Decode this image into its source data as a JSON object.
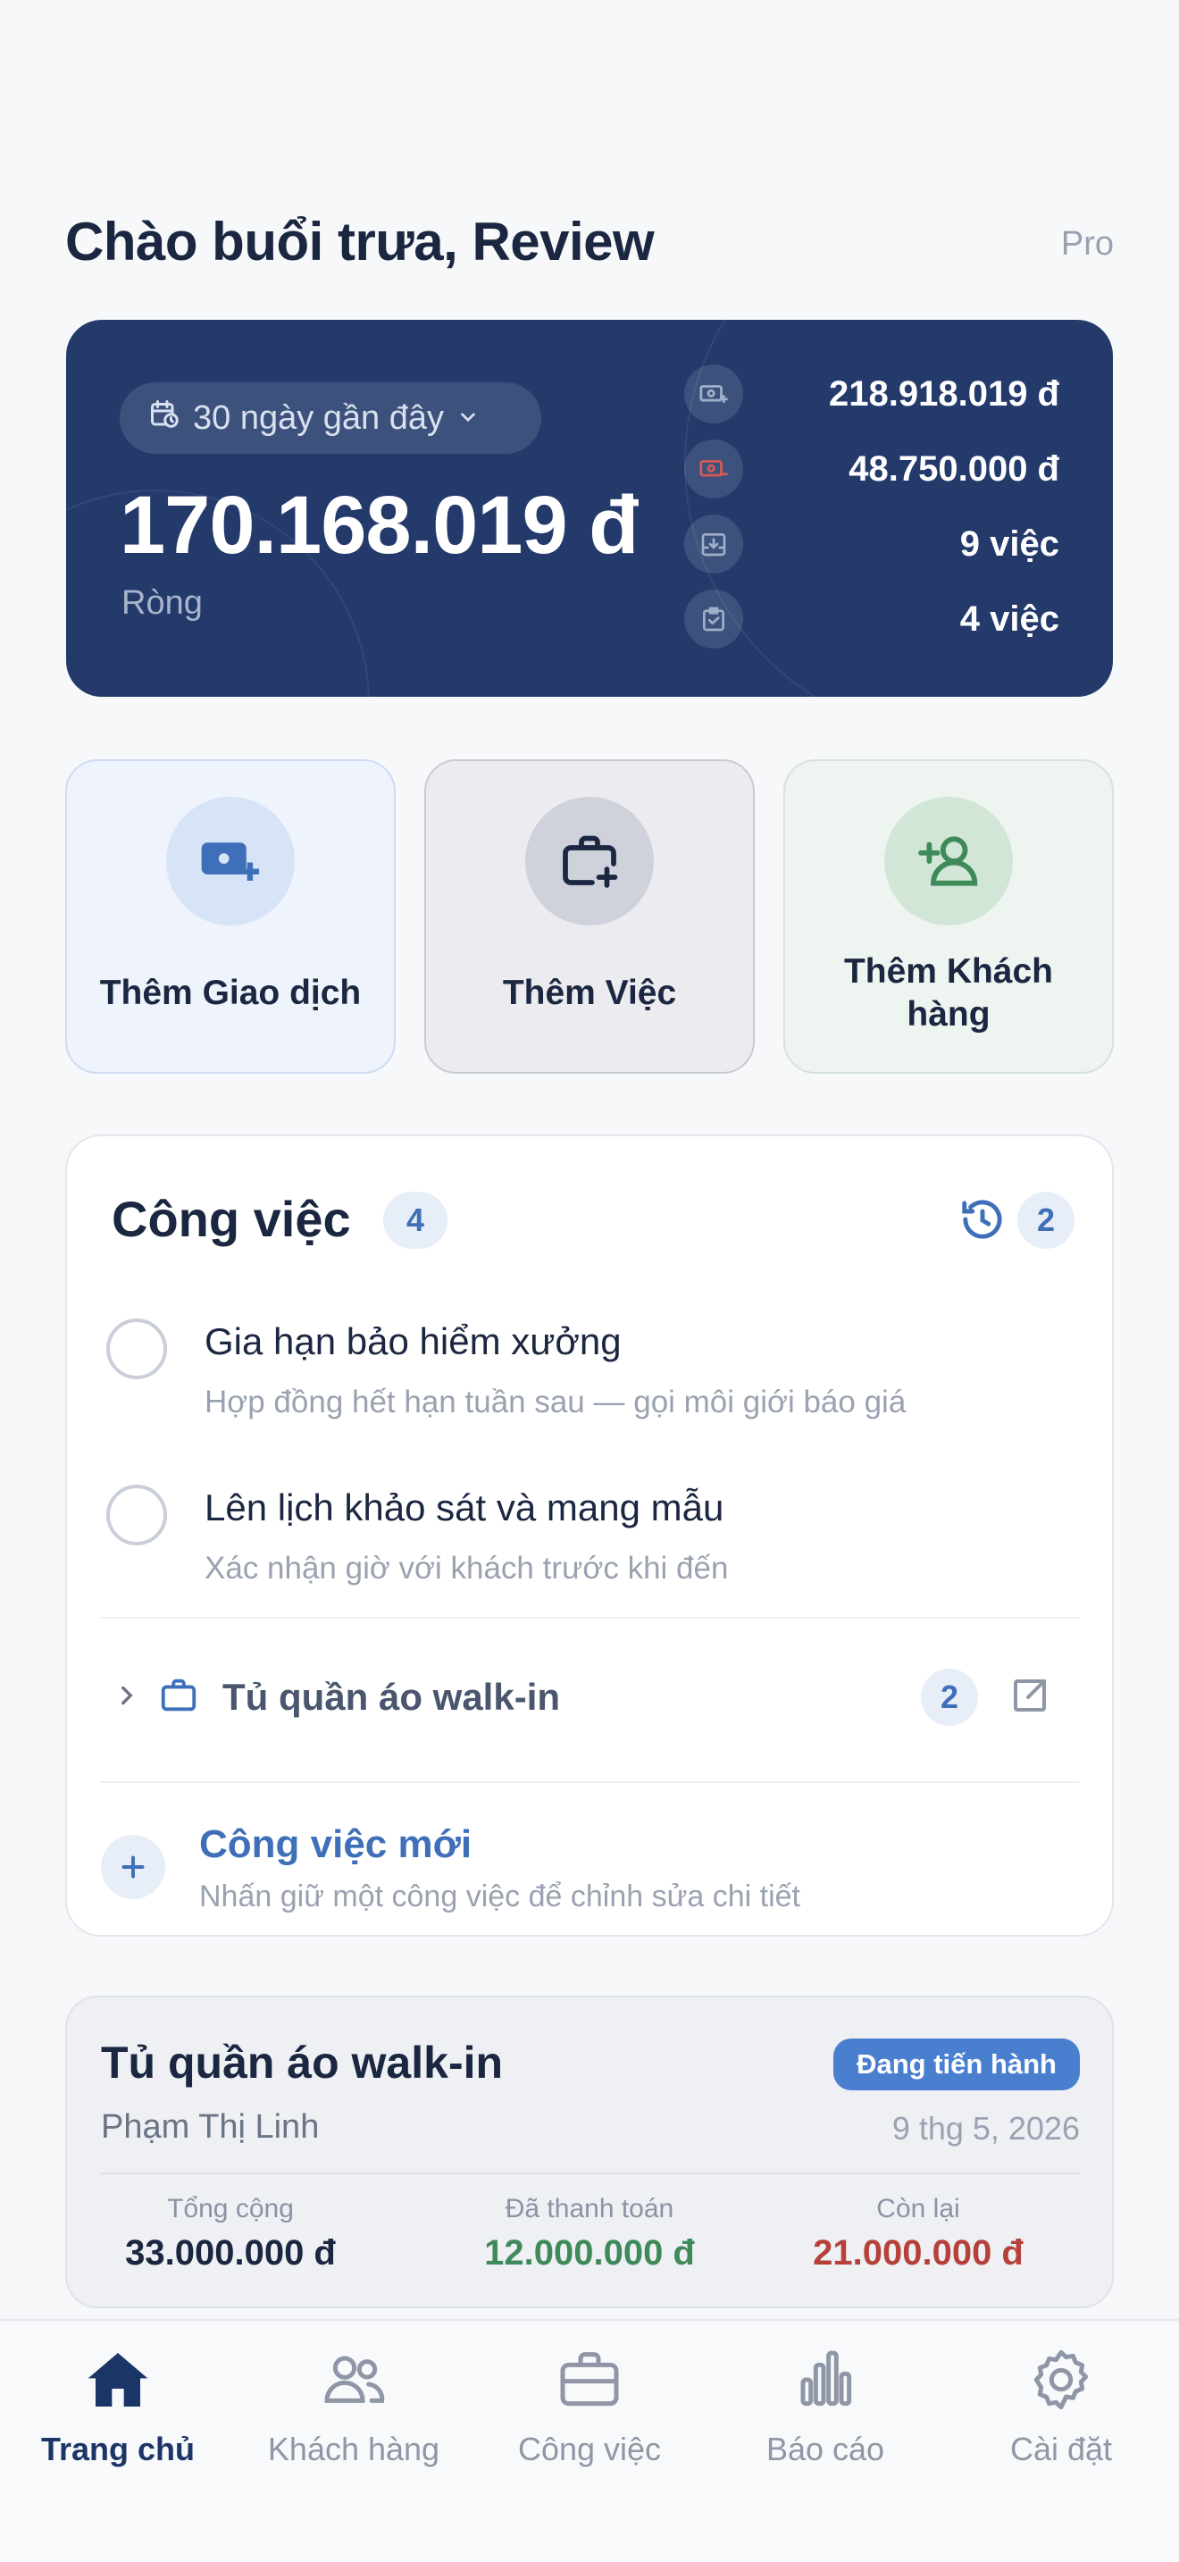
{
  "header": {
    "greeting": "Chào buổi trưa, Review",
    "plan": "Pro"
  },
  "summary": {
    "range_label": "30 ngày gần đây",
    "net_amount": "170.168.019 đ",
    "net_label": "Ròng",
    "stats": [
      {
        "icon": "money-in-icon",
        "value": "218.918.019 đ"
      },
      {
        "icon": "money-out-icon",
        "value": "48.750.000 đ"
      },
      {
        "icon": "inbox-download-icon",
        "value": "9 việc"
      },
      {
        "icon": "clipboard-check-icon",
        "value": "4 việc"
      }
    ]
  },
  "quick_actions": {
    "add_transaction": "Thêm Giao dịch",
    "add_job": "Thêm Việc",
    "add_customer": "Thêm Khách hàng"
  },
  "jobs": {
    "title": "Công việc",
    "count": "4",
    "history_count": "2",
    "tasks": [
      {
        "title": "Gia hạn bảo hiểm xưởng",
        "subtitle": "Hợp đồng hết hạn tuần sau — gọi môi giới báo giá"
      },
      {
        "title": "Lên lịch khảo sát và mang mẫu",
        "subtitle": "Xác nhận giờ với khách trước khi đến"
      }
    ],
    "project_group": {
      "name": "Tủ quần áo walk-in",
      "count": "2"
    },
    "new_job": {
      "title": "Công việc mới",
      "hint": "Nhấn giữ một công việc để chỉnh sửa chi tiết"
    }
  },
  "project_card": {
    "title": "Tủ quần áo walk-in",
    "status": "Đang tiến hành",
    "client": "Phạm Thị Linh",
    "date": "9 thg 5, 2026",
    "total_label": "Tổng cộng",
    "total_value": "33.000.000 đ",
    "paid_label": "Đã thanh toán",
    "paid_value": "12.000.000 đ",
    "remaining_label": "Còn lại",
    "remaining_value": "21.000.000 đ"
  },
  "colors": {
    "navy": "#233a6b",
    "accent": "#3f6fb8",
    "paid_green": "#3f8a5a",
    "remaining_red": "#b6403a"
  },
  "tabs": [
    {
      "label": "Trang chủ",
      "icon": "home-icon",
      "active": true
    },
    {
      "label": "Khách hàng",
      "icon": "users-icon",
      "active": false
    },
    {
      "label": "Công việc",
      "icon": "briefcase-icon",
      "active": false
    },
    {
      "label": "Báo cáo",
      "icon": "bar-chart-icon",
      "active": false
    },
    {
      "label": "Cài đặt",
      "icon": "gear-icon",
      "active": false
    }
  ]
}
